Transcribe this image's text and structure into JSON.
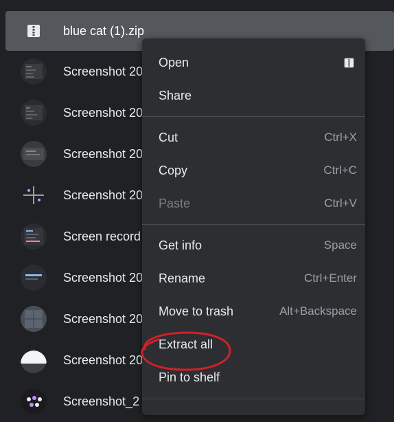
{
  "files": [
    {
      "name": "blue cat (1).zip",
      "icon": "zip-icon",
      "selected": true
    },
    {
      "name": "Screenshot 20",
      "icon": "image-thumbnail"
    },
    {
      "name": "Screenshot 20",
      "icon": "image-thumbnail"
    },
    {
      "name": "Screenshot 20",
      "icon": "image-thumbnail"
    },
    {
      "name": "Screenshot 20",
      "icon": "image-thumbnail"
    },
    {
      "name": "Screen record",
      "icon": "video-thumbnail"
    },
    {
      "name": "Screenshot 20",
      "icon": "image-thumbnail"
    },
    {
      "name": "Screenshot 20",
      "icon": "image-thumbnail"
    },
    {
      "name": "Screenshot 20",
      "icon": "image-thumbnail"
    },
    {
      "name": "Screenshot_2",
      "icon": "image-thumbnail"
    }
  ],
  "menu": {
    "open": {
      "label": "Open",
      "icon": "zip-icon"
    },
    "share": {
      "label": "Share"
    },
    "cut": {
      "label": "Cut",
      "shortcut": "Ctrl+X"
    },
    "copy": {
      "label": "Copy",
      "shortcut": "Ctrl+C"
    },
    "paste": {
      "label": "Paste",
      "shortcut": "Ctrl+V",
      "disabled": true
    },
    "get_info": {
      "label": "Get info",
      "shortcut": "Space"
    },
    "rename": {
      "label": "Rename",
      "shortcut": "Ctrl+Enter"
    },
    "move_to_trash": {
      "label": "Move to trash",
      "shortcut": "Alt+Backspace"
    },
    "extract_all": {
      "label": "Extract all",
      "highlighted": true
    },
    "pin_to_shelf": {
      "label": "Pin to shelf"
    }
  },
  "colors": {
    "background": "#202124",
    "selected_row": "#54575c",
    "menu_background": "#2d2e31",
    "annotation_circle": "#d2202a"
  }
}
